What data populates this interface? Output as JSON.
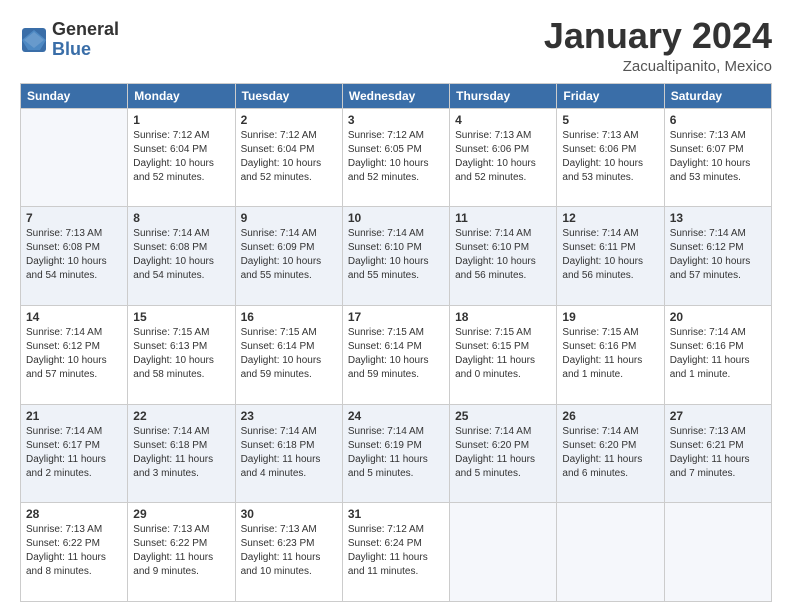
{
  "header": {
    "logo_general": "General",
    "logo_blue": "Blue",
    "month_title": "January 2024",
    "location": "Zacualtipanito, Mexico"
  },
  "days_of_week": [
    "Sunday",
    "Monday",
    "Tuesday",
    "Wednesday",
    "Thursday",
    "Friday",
    "Saturday"
  ],
  "weeks": [
    [
      {
        "day": "",
        "info": ""
      },
      {
        "day": "1",
        "info": "Sunrise: 7:12 AM\nSunset: 6:04 PM\nDaylight: 10 hours\nand 52 minutes."
      },
      {
        "day": "2",
        "info": "Sunrise: 7:12 AM\nSunset: 6:04 PM\nDaylight: 10 hours\nand 52 minutes."
      },
      {
        "day": "3",
        "info": "Sunrise: 7:12 AM\nSunset: 6:05 PM\nDaylight: 10 hours\nand 52 minutes."
      },
      {
        "day": "4",
        "info": "Sunrise: 7:13 AM\nSunset: 6:06 PM\nDaylight: 10 hours\nand 52 minutes."
      },
      {
        "day": "5",
        "info": "Sunrise: 7:13 AM\nSunset: 6:06 PM\nDaylight: 10 hours\nand 53 minutes."
      },
      {
        "day": "6",
        "info": "Sunrise: 7:13 AM\nSunset: 6:07 PM\nDaylight: 10 hours\nand 53 minutes."
      }
    ],
    [
      {
        "day": "7",
        "info": "Sunrise: 7:13 AM\nSunset: 6:08 PM\nDaylight: 10 hours\nand 54 minutes."
      },
      {
        "day": "8",
        "info": "Sunrise: 7:14 AM\nSunset: 6:08 PM\nDaylight: 10 hours\nand 54 minutes."
      },
      {
        "day": "9",
        "info": "Sunrise: 7:14 AM\nSunset: 6:09 PM\nDaylight: 10 hours\nand 55 minutes."
      },
      {
        "day": "10",
        "info": "Sunrise: 7:14 AM\nSunset: 6:10 PM\nDaylight: 10 hours\nand 55 minutes."
      },
      {
        "day": "11",
        "info": "Sunrise: 7:14 AM\nSunset: 6:10 PM\nDaylight: 10 hours\nand 56 minutes."
      },
      {
        "day": "12",
        "info": "Sunrise: 7:14 AM\nSunset: 6:11 PM\nDaylight: 10 hours\nand 56 minutes."
      },
      {
        "day": "13",
        "info": "Sunrise: 7:14 AM\nSunset: 6:12 PM\nDaylight: 10 hours\nand 57 minutes."
      }
    ],
    [
      {
        "day": "14",
        "info": "Sunrise: 7:14 AM\nSunset: 6:12 PM\nDaylight: 10 hours\nand 57 minutes."
      },
      {
        "day": "15",
        "info": "Sunrise: 7:15 AM\nSunset: 6:13 PM\nDaylight: 10 hours\nand 58 minutes."
      },
      {
        "day": "16",
        "info": "Sunrise: 7:15 AM\nSunset: 6:14 PM\nDaylight: 10 hours\nand 59 minutes."
      },
      {
        "day": "17",
        "info": "Sunrise: 7:15 AM\nSunset: 6:14 PM\nDaylight: 10 hours\nand 59 minutes."
      },
      {
        "day": "18",
        "info": "Sunrise: 7:15 AM\nSunset: 6:15 PM\nDaylight: 11 hours\nand 0 minutes."
      },
      {
        "day": "19",
        "info": "Sunrise: 7:15 AM\nSunset: 6:16 PM\nDaylight: 11 hours\nand 1 minute."
      },
      {
        "day": "20",
        "info": "Sunrise: 7:14 AM\nSunset: 6:16 PM\nDaylight: 11 hours\nand 1 minute."
      }
    ],
    [
      {
        "day": "21",
        "info": "Sunrise: 7:14 AM\nSunset: 6:17 PM\nDaylight: 11 hours\nand 2 minutes."
      },
      {
        "day": "22",
        "info": "Sunrise: 7:14 AM\nSunset: 6:18 PM\nDaylight: 11 hours\nand 3 minutes."
      },
      {
        "day": "23",
        "info": "Sunrise: 7:14 AM\nSunset: 6:18 PM\nDaylight: 11 hours\nand 4 minutes."
      },
      {
        "day": "24",
        "info": "Sunrise: 7:14 AM\nSunset: 6:19 PM\nDaylight: 11 hours\nand 5 minutes."
      },
      {
        "day": "25",
        "info": "Sunrise: 7:14 AM\nSunset: 6:20 PM\nDaylight: 11 hours\nand 5 minutes."
      },
      {
        "day": "26",
        "info": "Sunrise: 7:14 AM\nSunset: 6:20 PM\nDaylight: 11 hours\nand 6 minutes."
      },
      {
        "day": "27",
        "info": "Sunrise: 7:13 AM\nSunset: 6:21 PM\nDaylight: 11 hours\nand 7 minutes."
      }
    ],
    [
      {
        "day": "28",
        "info": "Sunrise: 7:13 AM\nSunset: 6:22 PM\nDaylight: 11 hours\nand 8 minutes."
      },
      {
        "day": "29",
        "info": "Sunrise: 7:13 AM\nSunset: 6:22 PM\nDaylight: 11 hours\nand 9 minutes."
      },
      {
        "day": "30",
        "info": "Sunrise: 7:13 AM\nSunset: 6:23 PM\nDaylight: 11 hours\nand 10 minutes."
      },
      {
        "day": "31",
        "info": "Sunrise: 7:12 AM\nSunset: 6:24 PM\nDaylight: 11 hours\nand 11 minutes."
      },
      {
        "day": "",
        "info": ""
      },
      {
        "day": "",
        "info": ""
      },
      {
        "day": "",
        "info": ""
      }
    ]
  ]
}
